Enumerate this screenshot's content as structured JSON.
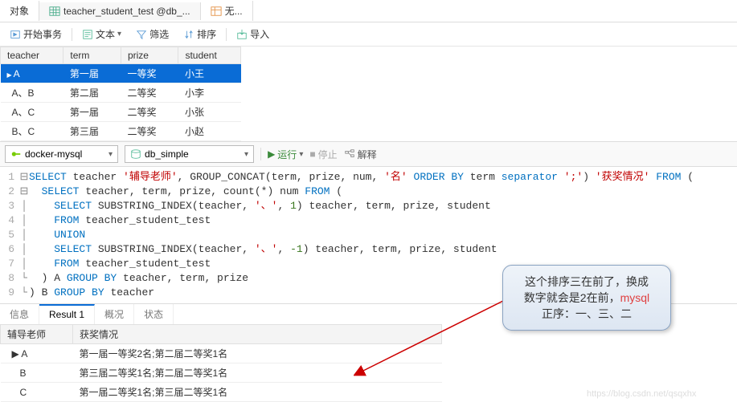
{
  "tabs": {
    "objects": "对象",
    "active": "teacher_student_test @db_...",
    "untitled": "无..."
  },
  "toolbar": {
    "begin": "开始事务",
    "text": "文本",
    "filter": "筛选",
    "sort": "排序",
    "import": "导入"
  },
  "grid": {
    "cols": [
      "teacher",
      "term",
      "prize",
      "student"
    ],
    "rows": [
      [
        "A",
        "第一届",
        "一等奖",
        "小王"
      ],
      [
        "A、B",
        "第二届",
        "二等奖",
        "小李"
      ],
      [
        "A、C",
        "第一届",
        "二等奖",
        "小张"
      ],
      [
        "B、C",
        "第三届",
        "二等奖",
        "小赵"
      ]
    ]
  },
  "conn": {
    "server": "docker-mysql",
    "database": "db_simple",
    "run": "运行",
    "stop": "停止",
    "explain": "解释"
  },
  "sql": {
    "lines": [
      "SELECT teacher '辅导老师', GROUP_CONCAT(term, prize, num, '名' ORDER BY term separator ';') '获奖情况' FROM (",
      "  SELECT teacher, term, prize, count(*) num FROM (",
      "    SELECT SUBSTRING_INDEX(teacher, '、', 1) teacher, term, prize, student",
      "    FROM teacher_student_test",
      "    UNION",
      "    SELECT SUBSTRING_INDEX(teacher, '、', -1) teacher, term, prize, student",
      "    FROM teacher_student_test",
      "  ) A GROUP BY teacher, term, prize",
      ") B GROUP BY teacher"
    ]
  },
  "resultTabs": {
    "info": "信息",
    "r1": "Result 1",
    "profile": "概况",
    "status": "状态"
  },
  "result": {
    "cols": [
      "辅导老师",
      "获奖情况"
    ],
    "rows": [
      [
        "A",
        "第一届一等奖2名;第二届二等奖1名"
      ],
      [
        "B",
        "第三届二等奖1名;第二届二等奖1名"
      ],
      [
        "C",
        "第一届二等奖1名;第三届二等奖1名"
      ]
    ]
  },
  "callout": {
    "l1": "这个排序三在前了，换成",
    "l2a": "数字就会是2在前，",
    "l2b": "mysql",
    "l3": "正序：一、三、二"
  },
  "watermark": "https://blog.csdn.net/qsqxhx"
}
